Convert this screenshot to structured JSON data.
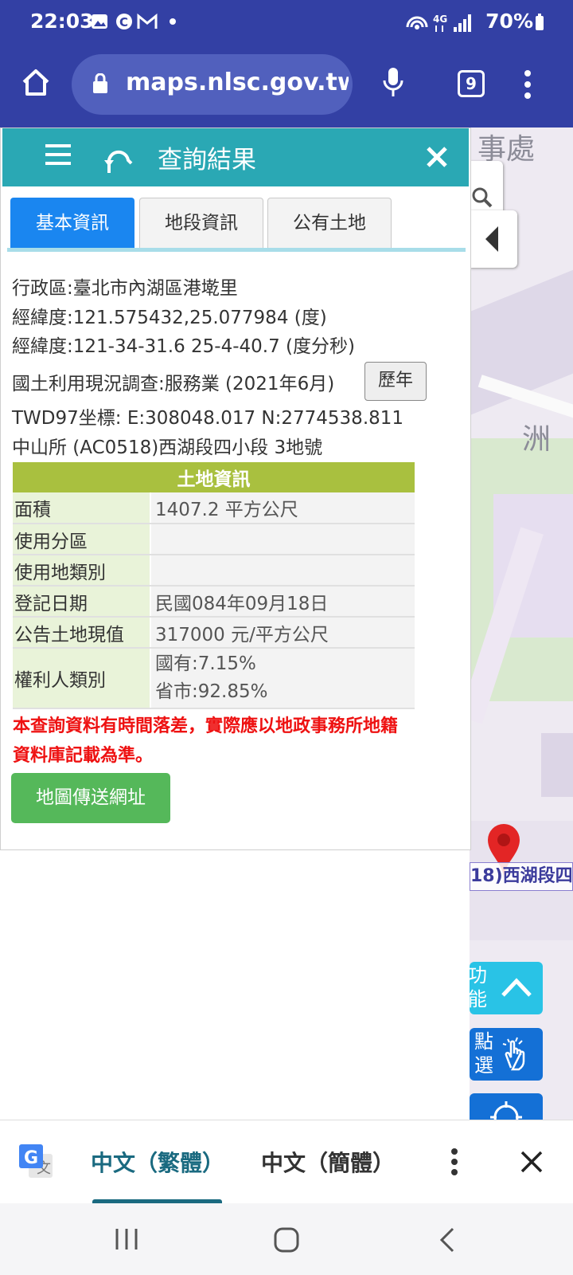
{
  "status": {
    "time": "22:03",
    "battery": "70%"
  },
  "browser": {
    "url": "maps.nlsc.gov.tw/",
    "tab_count": "9"
  },
  "panel": {
    "title": "查詢結果",
    "tabs": [
      {
        "label": "基本資訊",
        "active": true
      },
      {
        "label": "地段資訊",
        "active": false
      },
      {
        "label": "公有土地",
        "active": false
      }
    ],
    "info": {
      "district": "行政區:臺北市內湖區港墘里",
      "lonlat_deg": "經緯度:121.575432,25.077984 (度)",
      "lonlat_dms": "經緯度:121-34-31.6 25-4-40.7 (度分秒)",
      "land_use": "國土利用現況調查:服務業 (2021年6月)",
      "history_button": "歷年",
      "twd97": "TWD97坐標: E:308048.017 N:2774538.811",
      "parcel": "中山所 (AC0518)西湖段四小段 3地號"
    },
    "land_table": {
      "title": "土地資訊",
      "rows": [
        {
          "key": "面積",
          "value": "1407.2 平方公尺"
        },
        {
          "key": "使用分區",
          "value": ""
        },
        {
          "key": "使用地類別",
          "value": ""
        },
        {
          "key": "登記日期",
          "value": "民國084年09月18日"
        },
        {
          "key": "公告土地現值",
          "value": "317000 元/平方公尺"
        },
        {
          "key": "權利人類別",
          "value": "國有:7.15%",
          "value2": "省市:92.85%"
        }
      ]
    },
    "warning": "本查詢資料有時間落差，實際應以地政事務所地籍資料庫記載為準。",
    "share_button": "地圖傳送網址"
  },
  "map": {
    "label_top": "事處",
    "label_mid": "洲",
    "marker_label": "18)西湖段四",
    "func_button": "功能",
    "click_button": "點選"
  },
  "translate": {
    "lang_traditional": "中文（繁體）",
    "lang_simplified": "中文（簡體）"
  },
  "colors": {
    "browser_bar": "#3340a4",
    "panel_header": "#2aa8b4",
    "active_tab": "#1a86f0",
    "table_header": "#a9c03f",
    "warning": "#e11111",
    "share_button": "#55b85a",
    "translate_accent": "#1a6a80"
  }
}
